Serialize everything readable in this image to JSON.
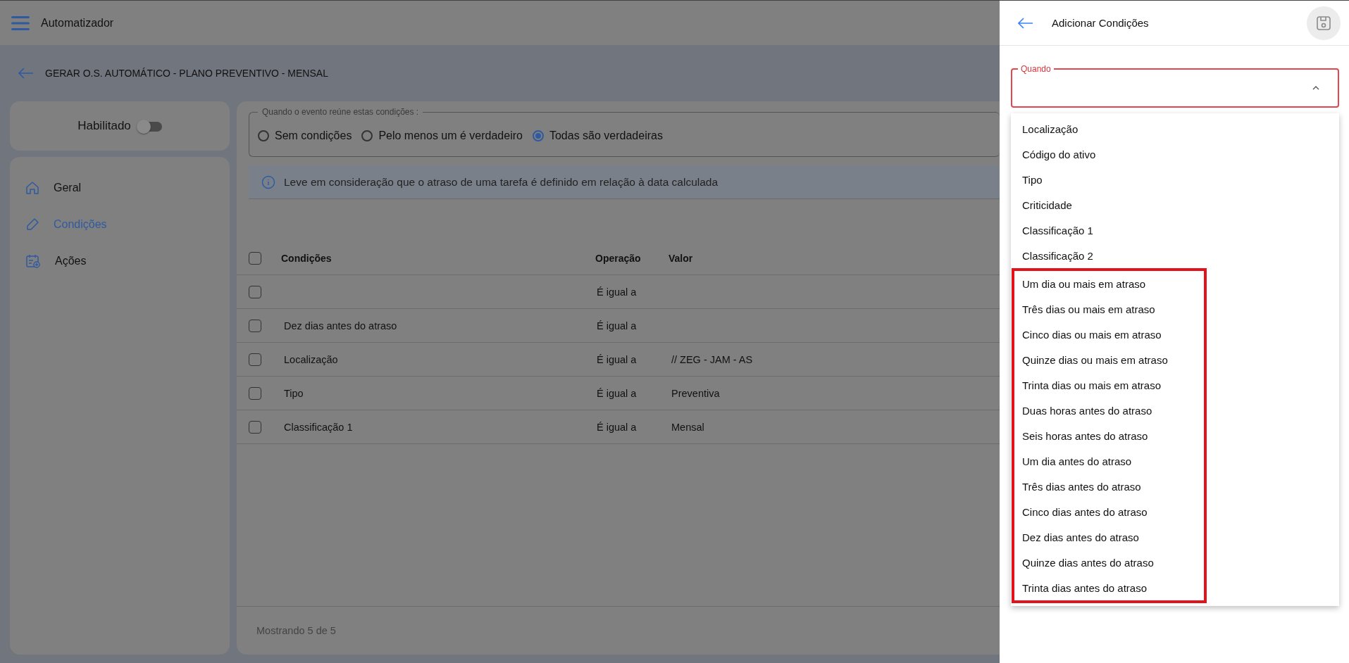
{
  "app_bar": {
    "title": "Automatizador"
  },
  "breadcrumb": {
    "title": "GERAR O.S. AUTOMÁTICO - PLANO PREVENTIVO - MENSAL"
  },
  "enabled_toggle": {
    "label": "Habilitado",
    "on": false
  },
  "nav": [
    {
      "label": "Geral",
      "selected": false
    },
    {
      "label": "Condições",
      "selected": true
    },
    {
      "label": "Ações",
      "selected": false
    }
  ],
  "condition_mode": {
    "legend": "Quando o evento reúne estas condições :",
    "options": [
      {
        "label": "Sem condições",
        "selected": false
      },
      {
        "label": "Pelo menos um é verdadeiro",
        "selected": false
      },
      {
        "label": "Todas são verdadeiras",
        "selected": true
      }
    ]
  },
  "info": "Leve em consideração que o atraso de uma tarefa é definido em relação à data calculada",
  "table": {
    "select_all_checked": false,
    "columns": [
      "Condições",
      "Operação",
      "Valor"
    ],
    "rows": [
      {
        "checked": false,
        "cells": [
          "",
          "É igual a",
          ""
        ]
      },
      {
        "checked": false,
        "cells": [
          "Dez dias antes do atraso",
          "É igual a",
          ""
        ]
      },
      {
        "checked": false,
        "cells": [
          "Localização",
          "É igual a",
          "// ZEG - JAM - AS"
        ]
      },
      {
        "checked": false,
        "cells": [
          "Tipo",
          "É igual a",
          "Preventiva"
        ]
      },
      {
        "checked": false,
        "cells": [
          "Classificação 1",
          "É igual a",
          "Mensal"
        ]
      }
    ],
    "footer": "Mostrando 5 de 5"
  },
  "panel": {
    "title": "Adicionar Condições",
    "select": {
      "label": "Quando",
      "expanded": true
    },
    "options": [
      {
        "label": "Localização",
        "highlighted": false
      },
      {
        "label": "Código do ativo",
        "highlighted": false
      },
      {
        "label": "Tipo",
        "highlighted": false
      },
      {
        "label": "Criticidade",
        "highlighted": false
      },
      {
        "label": "Classificação 1",
        "highlighted": false
      },
      {
        "label": "Classificação 2",
        "highlighted": false
      },
      {
        "label": "Um dia ou mais em atraso",
        "highlighted": true
      },
      {
        "label": "Três dias ou mais em atraso",
        "highlighted": true
      },
      {
        "label": "Cinco dias ou mais em atraso",
        "highlighted": true
      },
      {
        "label": "Quinze dias ou mais em atraso",
        "highlighted": true
      },
      {
        "label": "Trinta dias ou mais em atraso",
        "highlighted": true
      },
      {
        "label": "Duas horas antes do atraso",
        "highlighted": true
      },
      {
        "label": "Seis horas antes do atraso",
        "highlighted": true
      },
      {
        "label": "Um dia antes do atraso",
        "highlighted": true
      },
      {
        "label": "Três dias antes do atraso",
        "highlighted": true
      },
      {
        "label": "Cinco dias antes do atraso",
        "highlighted": true
      },
      {
        "label": "Dez dias antes do atraso",
        "highlighted": true
      },
      {
        "label": "Quinze dias antes do atraso",
        "highlighted": true
      },
      {
        "label": "Trinta dias antes do atraso",
        "highlighted": true
      }
    ]
  }
}
